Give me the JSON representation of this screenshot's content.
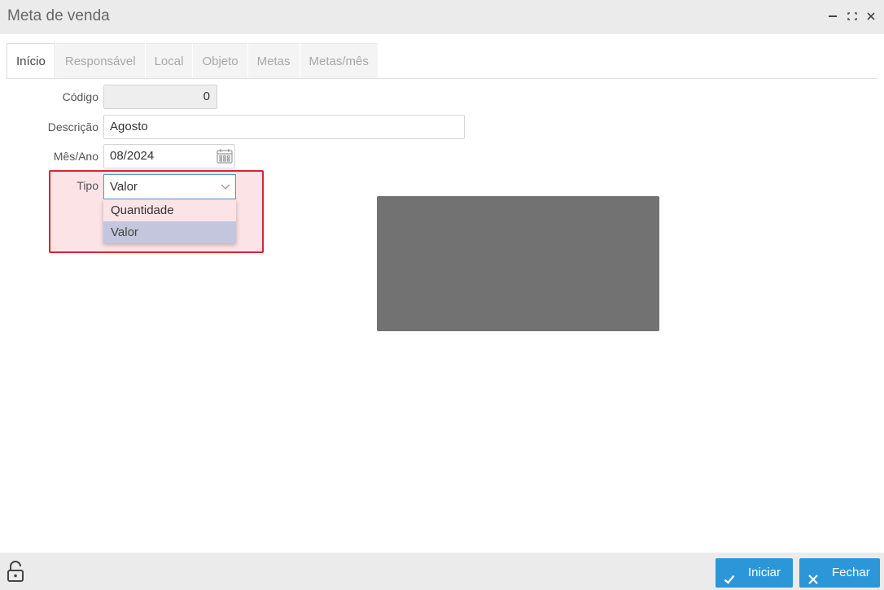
{
  "window": {
    "title": "Meta de venda",
    "controls": [
      "minimize-icon",
      "maximize-icon",
      "close-icon"
    ]
  },
  "tabs": [
    {
      "label": "Início",
      "active": true
    },
    {
      "label": "Responsável",
      "active": false
    },
    {
      "label": "Local",
      "active": false
    },
    {
      "label": "Objeto",
      "active": false
    },
    {
      "label": "Metas",
      "active": false
    },
    {
      "label": "Metas/mês",
      "active": false
    }
  ],
  "form": {
    "codigo": {
      "label": "Código",
      "value": "0"
    },
    "descricao": {
      "label": "Descrição",
      "value": "Agosto"
    },
    "mes_ano": {
      "label": "Mês/Ano",
      "value": "08/2024",
      "icon": "calendar-icon"
    },
    "tipo": {
      "label": "Tipo",
      "value": "Valor",
      "options": [
        "Quantidade",
        "Valor"
      ],
      "selected_option": "Valor"
    }
  },
  "footer": {
    "lock_icon": "lock-open-icon",
    "iniciar_label": "Iniciar",
    "fechar_label": "Fechar"
  },
  "colors": {
    "accent": "#2b96d8",
    "highlight_border": "#d8242f",
    "highlight_fill": "#fbe3e6",
    "selected_option": "#c3c6dc"
  }
}
